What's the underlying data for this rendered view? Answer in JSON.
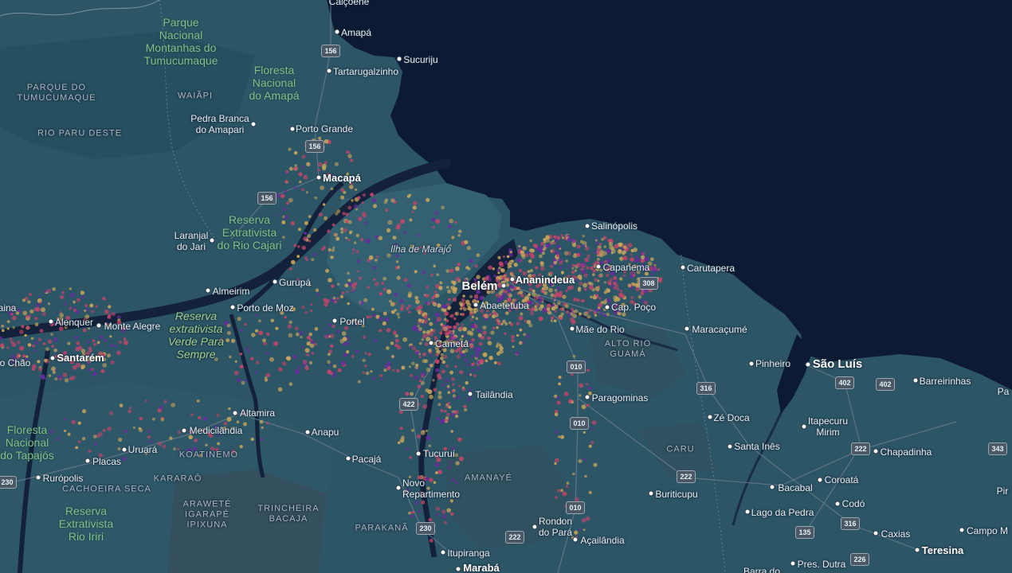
{
  "colors": {
    "ocean": "#0d1a33",
    "land": "#2c5566",
    "land_dark": "#244a58",
    "river": "#13223a",
    "park_text": "#7fc08a",
    "heat_low": "#c9a55a",
    "heat_mid": "#c2456a",
    "heat_high": "#6a2aa0"
  },
  "labels": {
    "calcoene": "Calçoene",
    "amapa": "Amapá",
    "sucuriju": "Sucuriju",
    "tartarugalzinho": "Tartarugalzinho",
    "pedra_branca": "Pedra Branca\ndo Amapari",
    "porto_grande": "Porto Grande",
    "macapa": "Macapá",
    "laranjal": "Laranjal\ndo Jari",
    "almeirim": "Almeirim",
    "gurupa": "Gurupá",
    "porto_de_moz": "Porto de Moz",
    "portel": "Portel",
    "ilha_marajo": "Ilha de Marajó",
    "salinopolis": "Salinópolis",
    "capanema": "Capanema",
    "carutapera": "Carutapera",
    "belem": "Belém",
    "ananindeua": "Ananindeua",
    "abaetetuba": "Abaetetuba",
    "cap_poco": "Cap. Poço",
    "mae_do_rio": "Mãe do Rio",
    "maracacume": "Maracaçumé",
    "cameta": "Cametá",
    "alenquer": "Alenquer",
    "monte_alegre": "Monte Alegre",
    "santarem": "Santarém",
    "chao": "o Chão",
    "aina": "aina",
    "pinheiro": "Pinheiro",
    "sao_luis": "São Luís",
    "barreirinhas": "Barreirinhas",
    "pa_edge": "Pa",
    "tailandia": "Tailândia",
    "paragominas": "Paragominas",
    "ze_doca": "Zé Doca",
    "itapecuru": "Itapecuru\nMirim",
    "chapadinha": "Chapadinha",
    "altamira": "Altamira",
    "medicilandia": "Medicilândia",
    "anapu": "Anapu",
    "uruara": "Uruará",
    "placas": "Placas",
    "ruropolis": "Rurópolis",
    "pacaja": "Pacajá",
    "tucurui": "Tucuruí",
    "novo_repartimento": "Novo\nRepartimento",
    "santa_ines": "Santa Inês",
    "bacabal": "Bacabal",
    "coroata": "Coroatá",
    "pir_edge": "Pir",
    "buriticupu": "Buriticupu",
    "lago_da_pedra": "Lago da Pedra",
    "codo": "Codó",
    "caxias": "Caxias",
    "campo_m": "Campo M",
    "teresina": "Teresina",
    "rondon": "Rondon\ndo Pará",
    "acailandia": "Açailândia",
    "itupiranga": "Itupiranga",
    "maraba": "Marabá",
    "pres_dutra": "Pres. Dutra",
    "barra_do": "Barra do",
    "park_tumucumaque": "Parque\nNacional\nMontanhas do\nTumucumaque",
    "park_amapa": "Floresta\nNacional\ndo Amapá",
    "park_rio_cajari": "Reserva\nExtrativista\ndo Rio Cajari",
    "park_verde": "Reserva\nextrativista\nVerde Para\nSempre",
    "park_tapajos": "Floresta\nNacional\ndo Tapajós",
    "park_iriri": "Reserva\nExtrativista\nRio Iriri",
    "reg_parque_tumucumaque": "PARQUE DO\nTUMUCUMAQUE",
    "reg_waiapi": "WAIÃPI",
    "reg_rio_paru": "RIO PARU DESTE",
    "reg_koatinemo": "KOATINEMO",
    "reg_cachoeira": "CACHOEIRA SECA",
    "reg_kararao": "KARARAÔ",
    "reg_arawete": "ARAWETÉ\nIGARAPÉ\nIPIXUNA",
    "reg_trincheira": "TRINCHEIRA\nBACAJA",
    "reg_parakana": "PARAKANÃ",
    "reg_amanaye": "AMANAYÉ",
    "reg_alto_rio_guama": "ALTO RIO\nGUAMÁ",
    "reg_caru": "CARU"
  },
  "shields": {
    "s156a": "156",
    "s156b": "156",
    "s156c": "156",
    "s308": "308",
    "s010a": "010",
    "s010b": "010",
    "s010c": "010",
    "s316a": "316",
    "s316b": "316",
    "s402a": "402",
    "s402b": "402",
    "s422": "422",
    "s230a": "230",
    "s230b": "230",
    "s222a": "222",
    "s222b": "222",
    "s222c": "222",
    "s343": "343",
    "s135": "135",
    "s226": "226"
  }
}
